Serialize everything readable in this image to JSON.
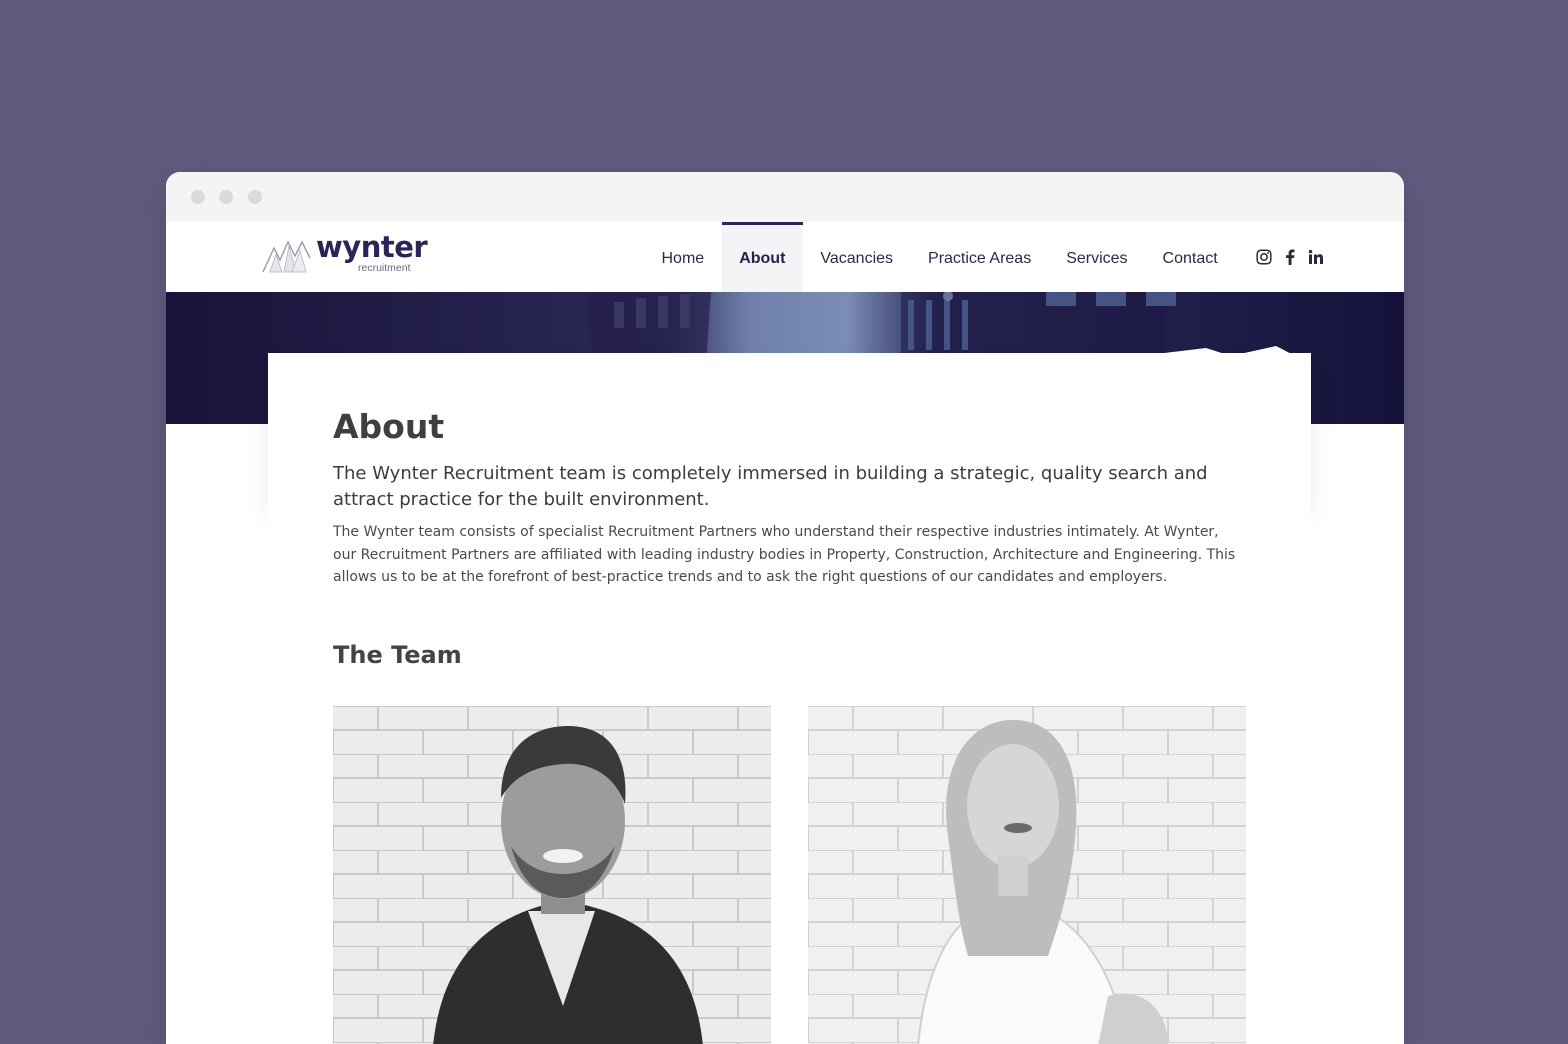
{
  "browser": {
    "dots": [
      "close",
      "minimize",
      "maximize"
    ]
  },
  "brand": {
    "name": "wynter",
    "tagline": "recruitment"
  },
  "nav": {
    "items": [
      {
        "label": "Home",
        "active": false
      },
      {
        "label": "About",
        "active": true
      },
      {
        "label": "Vacancies",
        "active": false
      },
      {
        "label": "Practice Areas",
        "active": false
      },
      {
        "label": "Services",
        "active": false
      },
      {
        "label": "Contact",
        "active": false
      }
    ]
  },
  "socials": [
    "instagram-icon",
    "facebook-icon",
    "linkedin-icon"
  ],
  "about": {
    "title": "About",
    "lead": "The Wynter Recruitment team is completely immersed in building a strategic, quality search and attract practice for the built environment.",
    "body": "The Wynter team consists of specialist Recruitment Partners who understand their respective industries intimately. At Wynter, our Recruitment Partners are affiliated with leading industry bodies in Property, Construction, Architecture and Engineering. This allows us to be at the forefront of best-practice trends and to ask the right questions of our candidates and employers."
  },
  "team": {
    "title": "The Team"
  },
  "colors": {
    "background": "#615a7e",
    "brand": "#2a2458",
    "text": "#3f3f3f"
  }
}
